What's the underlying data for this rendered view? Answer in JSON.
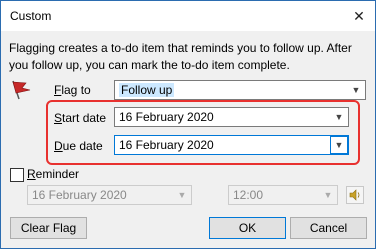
{
  "window": {
    "title": "Custom"
  },
  "intro_text": "Flagging creates a to-do item that reminds you to follow up. After you follow up, you can mark the to-do item complete.",
  "flag_to": {
    "label_accel": "F",
    "label_rest": "lag to",
    "value": "Follow up"
  },
  "start_date": {
    "label_accel": "S",
    "label_rest": "tart date",
    "value": "16 February 2020"
  },
  "due_date": {
    "label_accel": "D",
    "label_rest": "ue date",
    "value": "16 February 2020"
  },
  "reminder": {
    "label_accel": "R",
    "label_rest": "eminder",
    "checked": false,
    "date_value": "16 February 2020",
    "time_value": "12:00"
  },
  "buttons": {
    "clear_flag": "Clear Flag",
    "ok": "OK",
    "cancel": "Cancel"
  },
  "colors": {
    "accent": "#0078d7",
    "highlight_box": "#e8312f",
    "flag_red": "#c62828"
  },
  "icons": [
    "close-icon",
    "flag-icon",
    "chevron-down-icon",
    "speaker-icon"
  ]
}
